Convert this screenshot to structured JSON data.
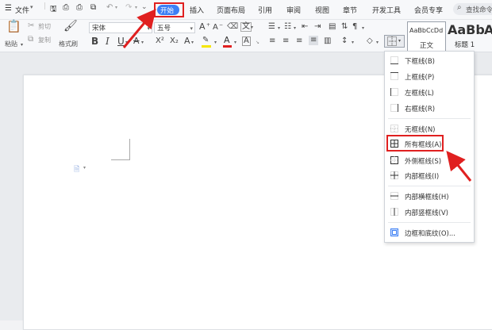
{
  "menubar": {
    "file_label": "文件",
    "tabs": [
      "开始",
      "插入",
      "页面布局",
      "引用",
      "审阅",
      "视图",
      "章节",
      "开发工具",
      "会员专享"
    ],
    "search_placeholder": "查找命令"
  },
  "ribbon": {
    "paste_label": "粘贴",
    "cut_label": "剪切",
    "copy_label": "复制",
    "format_painter_label": "格式刷",
    "font_name": "宋体",
    "font_size": "五号",
    "bold": "B",
    "italic": "I",
    "underline": "U",
    "grow_font": "A",
    "shrink_font": "A",
    "superscript": "X²",
    "subscript": "X₂",
    "highlight": "A",
    "font_color": "A",
    "phonetic": "文",
    "style_normal_preview": "AaBbCcDd",
    "style_normal_label": "正文",
    "style_heading1_preview": "AaBb",
    "style_heading1_label": "标题 1",
    "style_heading2_preview": "A"
  },
  "border_menu": {
    "items": [
      "下框线(B)",
      "上框线(P)",
      "左框线(L)",
      "右框线(R)",
      "无框线(N)",
      "所有框线(A)",
      "外侧框线(S)",
      "内部框线(I)",
      "内部横框线(H)",
      "内部竖框线(V)",
      "边框和底纹(O)..."
    ]
  },
  "colors": {
    "accent": "#3d7ff5",
    "highlight_red": "#e02020",
    "active_tab_bg": "#3d7ff5"
  }
}
